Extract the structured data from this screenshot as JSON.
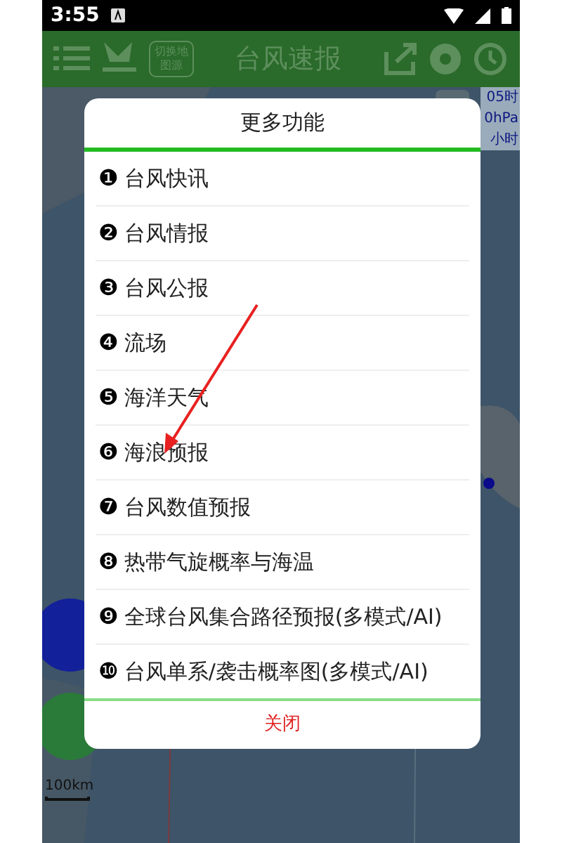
{
  "status_bar": {
    "time": "3:55"
  },
  "header": {
    "title": "台风速报",
    "map_switch": "切换地图源"
  },
  "info": {
    "line_1": "05时",
    "line_2": "0hPa",
    "line_3": "小时"
  },
  "scale": {
    "label": "100km"
  },
  "dialog": {
    "title": "更多功能",
    "items": [
      {
        "marker": "❶",
        "label": "台风快讯"
      },
      {
        "marker": "❷",
        "label": "台风情报"
      },
      {
        "marker": "❸",
        "label": "台风公报"
      },
      {
        "marker": "❹",
        "label": "流场"
      },
      {
        "marker": "❺",
        "label": "海洋天气"
      },
      {
        "marker": "❻",
        "label": "海浪预报"
      },
      {
        "marker": "❼",
        "label": "台风数值预报"
      },
      {
        "marker": "❽",
        "label": "热带气旋概率与海温"
      },
      {
        "marker": "❾",
        "label": "全球台风集合路径预报(多模式/AI)"
      },
      {
        "marker": "❿",
        "label": "台风单系/袭击概率图(多模式/AI)"
      }
    ],
    "close": "关闭"
  }
}
